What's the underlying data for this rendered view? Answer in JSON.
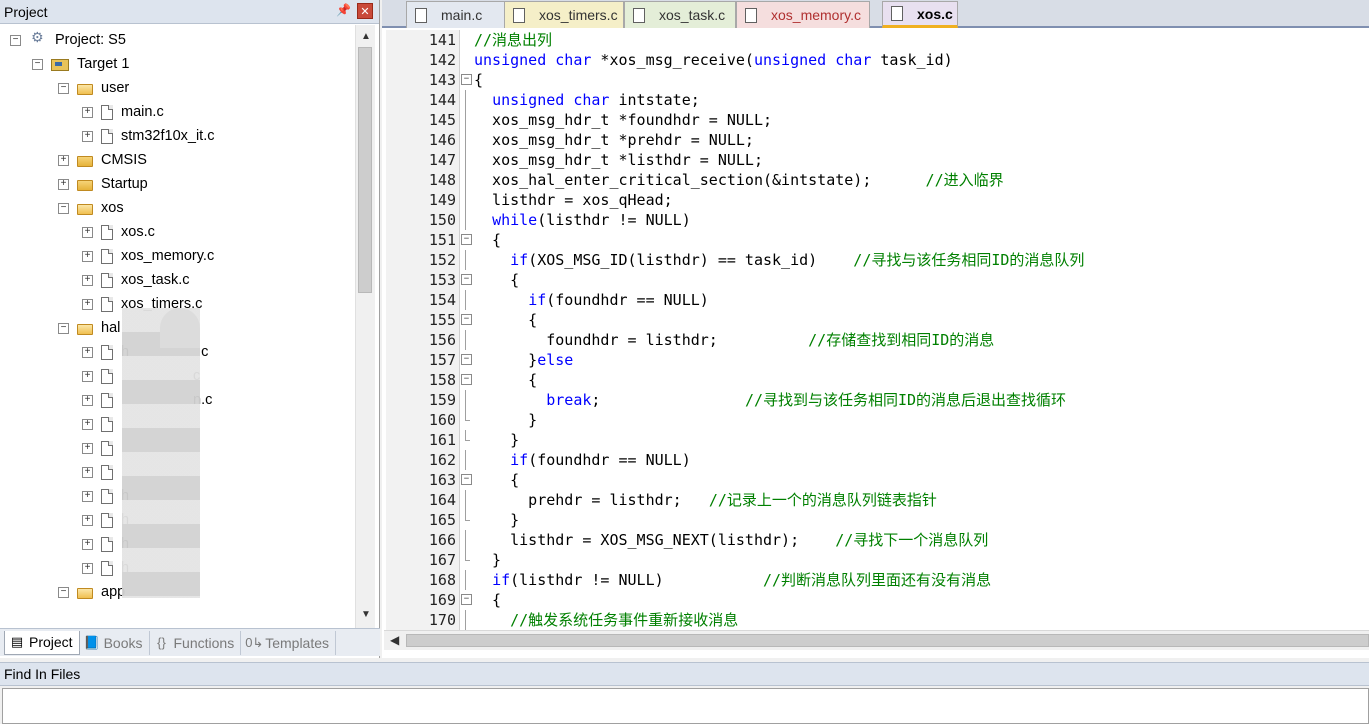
{
  "project_pane": {
    "title": "Project",
    "pin_icon": "pin-icon",
    "close_icon": "close-icon",
    "tree": [
      {
        "label": "Project: S5",
        "kind": "project",
        "depth": 0,
        "expander": "−"
      },
      {
        "label": "Target 1",
        "kind": "target",
        "depth": 1,
        "expander": "−"
      },
      {
        "label": "user",
        "kind": "folder-open",
        "depth": 2,
        "expander": "−"
      },
      {
        "label": "main.c",
        "kind": "file",
        "depth": 3,
        "expander": "+"
      },
      {
        "label": "stm32f10x_it.c",
        "kind": "file",
        "depth": 3,
        "expander": "+"
      },
      {
        "label": "CMSIS",
        "kind": "folder",
        "depth": 2,
        "expander": "+"
      },
      {
        "label": "Startup",
        "kind": "folder",
        "depth": 2,
        "expander": "+"
      },
      {
        "label": "xos",
        "kind": "folder-open",
        "depth": 2,
        "expander": "−"
      },
      {
        "label": "xos.c",
        "kind": "file",
        "depth": 3,
        "expander": "+"
      },
      {
        "label": "xos_memory.c",
        "kind": "file",
        "depth": 3,
        "expander": "+"
      },
      {
        "label": "xos_task.c",
        "kind": "file",
        "depth": 3,
        "expander": "+"
      },
      {
        "label": "xos_timers.c",
        "kind": "file",
        "depth": 3,
        "expander": "+"
      },
      {
        "label": "hal",
        "kind": "folder-open",
        "depth": 2,
        "expander": "−"
      },
      {
        "label": "h",
        "kind": "file",
        "depth": 3,
        "expander": "+"
      },
      {
        "label": "",
        "kind": "file",
        "depth": 3,
        "expander": "+"
      },
      {
        "label": "",
        "kind": "file",
        "depth": 3,
        "expander": "+"
      },
      {
        "label": "",
        "kind": "file",
        "depth": 3,
        "expander": "+"
      },
      {
        "label": "",
        "kind": "file",
        "depth": 3,
        "expander": "+"
      },
      {
        "label": "",
        "kind": "file",
        "depth": 3,
        "expander": "+"
      },
      {
        "label": "h",
        "kind": "file",
        "depth": 3,
        "expander": "+"
      },
      {
        "label": "h",
        "kind": "file",
        "depth": 3,
        "expander": "+"
      },
      {
        "label": "h",
        "kind": "file",
        "depth": 3,
        "expander": "+"
      },
      {
        "label": "h",
        "kind": "file",
        "depth": 3,
        "expander": "+"
      },
      {
        "label": "app",
        "kind": "folder-open",
        "depth": 2,
        "expander": "−"
      }
    ],
    "tree_label_tails": {
      "13": "c",
      "14": "c",
      "15": "n.c"
    },
    "tabs": [
      {
        "label": "Project",
        "icon": "project-tab-icon",
        "active": true
      },
      {
        "label": "Books",
        "icon": "books-icon",
        "active": false
      },
      {
        "label": "Functions",
        "icon": "functions-icon",
        "active": false
      },
      {
        "label": "Templates",
        "icon": "templates-icon",
        "active": false
      }
    ]
  },
  "editor": {
    "tabs": [
      {
        "label": "main.c",
        "active": false
      },
      {
        "label": "xos_timers.c",
        "active": false
      },
      {
        "label": "xos_task.c",
        "active": false
      },
      {
        "label": "xos_memory.c",
        "active": false
      },
      {
        "label": "xos.c",
        "active": true
      }
    ],
    "lines": [
      {
        "n": "141",
        "fold": "",
        "code": "//消息出列"
      },
      {
        "n": "142",
        "fold": "",
        "code": "unsigned char *xos_msg_receive(unsigned char task_id)"
      },
      {
        "n": "143",
        "fold": "box",
        "code": "{"
      },
      {
        "n": "144",
        "fold": "bar",
        "code": "  unsigned char intstate;"
      },
      {
        "n": "145",
        "fold": "bar",
        "code": "  xos_msg_hdr_t *foundhdr = NULL;"
      },
      {
        "n": "146",
        "fold": "bar",
        "code": "  xos_msg_hdr_t *prehdr = NULL;"
      },
      {
        "n": "147",
        "fold": "bar",
        "code": "  xos_msg_hdr_t *listhdr = NULL;"
      },
      {
        "n": "148",
        "fold": "bar",
        "code": "  xos_hal_enter_critical_section(&intstate);      //进入临界"
      },
      {
        "n": "149",
        "fold": "bar",
        "code": "  listhdr = xos_qHead;"
      },
      {
        "n": "150",
        "fold": "bar",
        "code": "  while(listhdr != NULL)"
      },
      {
        "n": "151",
        "fold": "box",
        "code": "  {"
      },
      {
        "n": "152",
        "fold": "bar",
        "code": "    if(XOS_MSG_ID(listhdr) == task_id)    //寻找与该任务相同ID的消息队列"
      },
      {
        "n": "153",
        "fold": "box",
        "code": "    {"
      },
      {
        "n": "154",
        "fold": "bar",
        "code": "      if(foundhdr == NULL)"
      },
      {
        "n": "155",
        "fold": "box",
        "code": "      {"
      },
      {
        "n": "156",
        "fold": "bar",
        "code": "        foundhdr = listhdr;          //存储查找到相同ID的消息"
      },
      {
        "n": "157",
        "fold": "box",
        "code": "      }else"
      },
      {
        "n": "158",
        "fold": "box",
        "code": "      {"
      },
      {
        "n": "159",
        "fold": "bar",
        "code": "        break;                //寻找到与该任务相同ID的消息后退出查找循环"
      },
      {
        "n": "160",
        "fold": "end",
        "code": "      }"
      },
      {
        "n": "161",
        "fold": "end",
        "code": "    }"
      },
      {
        "n": "162",
        "fold": "bar",
        "code": "    if(foundhdr == NULL)"
      },
      {
        "n": "163",
        "fold": "box",
        "code": "    {"
      },
      {
        "n": "164",
        "fold": "bar",
        "code": "      prehdr = listhdr;   //记录上一个的消息队列链表指针"
      },
      {
        "n": "165",
        "fold": "end",
        "code": "    }"
      },
      {
        "n": "166",
        "fold": "bar",
        "code": "    listhdr = XOS_MSG_NEXT(listhdr);    //寻找下一个消息队列"
      },
      {
        "n": "167",
        "fold": "end",
        "code": "  }"
      },
      {
        "n": "168",
        "fold": "bar",
        "code": "  if(listhdr != NULL)           //判断消息队列里面还有没有消息"
      },
      {
        "n": "169",
        "fold": "box",
        "code": "  {"
      },
      {
        "n": "170",
        "fold": "bar",
        "code": "    //触发系统任务事件重新接收消息"
      }
    ]
  },
  "find_in_files": {
    "title": "Find In Files"
  },
  "colors": {
    "keyword": "#0000ff",
    "comment": "#008000",
    "text": "#000000"
  }
}
